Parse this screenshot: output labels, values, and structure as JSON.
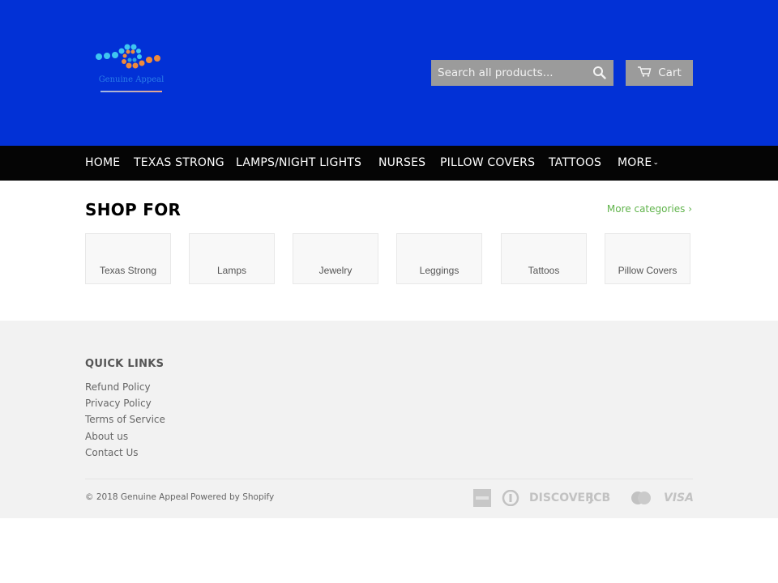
{
  "colors": {
    "header_bg": "#0231d6",
    "nav_bg": "#050505",
    "accent_link": "#61b44c",
    "button_bg": "#9b9b9b",
    "footer_bg": "#f2f2f2"
  },
  "header": {
    "logo_text": "Genuine Appeal",
    "search": {
      "placeholder": "Search all products...",
      "value": "",
      "icon": "search-icon"
    },
    "cart": {
      "label": "Cart",
      "icon": "cart-icon"
    }
  },
  "nav": {
    "items": [
      {
        "label": "HOME"
      },
      {
        "label": "TEXAS STRONG"
      },
      {
        "label": "LAMPS/NIGHT LIGHTS"
      },
      {
        "label": "NURSES"
      },
      {
        "label": "PILLOW COVERS"
      },
      {
        "label": "TATTOOS"
      },
      {
        "label": "MORE",
        "icon": "chevron-down-icon",
        "chevron": "⌄"
      }
    ]
  },
  "shop": {
    "title": "SHOP FOR",
    "more_link": "More categories ›",
    "categories": [
      {
        "label": "Texas Strong"
      },
      {
        "label": "Lamps"
      },
      {
        "label": "Jewelry"
      },
      {
        "label": "Leggings"
      },
      {
        "label": "Tattoos"
      },
      {
        "label": "Pillow Covers"
      }
    ]
  },
  "footer": {
    "quick_links_title": "QUICK LINKS",
    "quick_links": [
      "Refund Policy",
      "Privacy Policy",
      "Terms of Service",
      "About us",
      "Contact Us"
    ],
    "copyright": "© 2018 Genuine Appeal",
    "powered_by": "Powered by Shopify",
    "payment_icons": [
      {
        "name": "american-express-icon"
      },
      {
        "name": "diners-club-icon"
      },
      {
        "name": "discover-icon",
        "text": "DISCOVER"
      },
      {
        "name": "jcb-icon",
        "text": "JCB"
      },
      {
        "name": "master-icon"
      },
      {
        "name": "visa-icon",
        "text": "VISA"
      }
    ]
  }
}
